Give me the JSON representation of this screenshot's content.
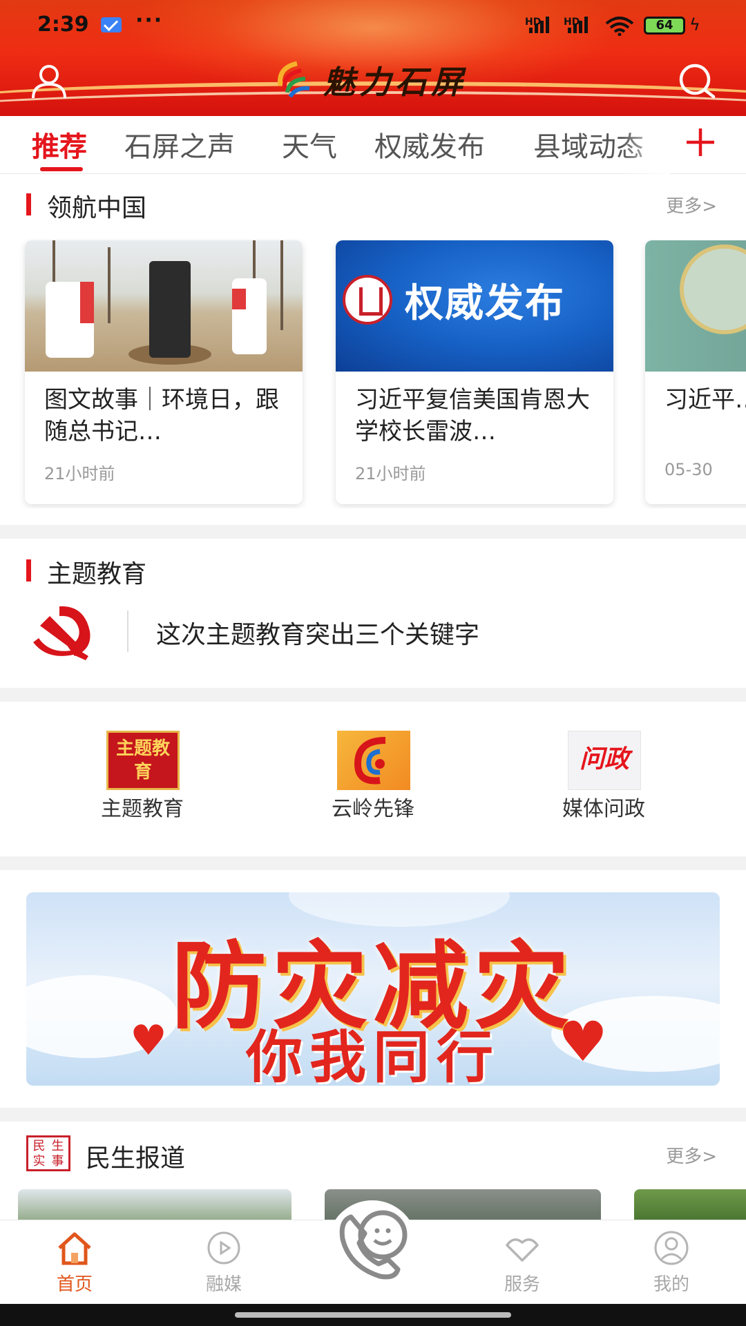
{
  "status_bar": {
    "time": "2:39",
    "dots": "···",
    "sim1_label": "HD",
    "sim2_label": "HD",
    "battery": "64"
  },
  "header": {
    "app_title": "魅力石屏",
    "icons": [
      "user-icon",
      "search-icon"
    ],
    "bg_color": "#e5221a"
  },
  "tabs": {
    "items": [
      "推荐",
      "石屏之声",
      "天气",
      "权威发布",
      "县域动态"
    ],
    "active_index": 0,
    "add_icon": "plus-icon",
    "accent": "#e5151c"
  },
  "lead_china": {
    "title": "领航中国",
    "more": "更多>",
    "cards": [
      {
        "title": "图文故事｜环境日，跟随总书记…",
        "time": "21小时前"
      },
      {
        "title": "习近平复信美国肯恩大学校长雷波…",
        "time": "21小时前",
        "thumb_text": "权威发布",
        "thumb_emblem": "XINHUA"
      },
      {
        "title": "习近平…作论坛…",
        "time": "05-30"
      }
    ]
  },
  "topic_education": {
    "title": "主题教育",
    "icon": "party-emblem-icon",
    "headline": "这次主题教育突出三个关键字"
  },
  "quick_links": [
    {
      "label": "主题教育",
      "icon_text": "主题教育"
    },
    {
      "label": "云岭先锋",
      "icon_text": ""
    },
    {
      "label": "媒体问政",
      "icon_text": "问政"
    }
  ],
  "banner": {
    "line1": "防灾减灾",
    "line2": "你我同行"
  },
  "minsheng": {
    "icon_chars": [
      "民",
      "生",
      "实",
      "事"
    ],
    "title": "民生报道",
    "more": "更多>"
  },
  "bottom_nav": {
    "items": [
      {
        "label": "首页",
        "icon": "home-icon"
      },
      {
        "label": "融媒",
        "icon": "media-icon"
      },
      {
        "label": "",
        "icon": "phone-smile-icon"
      },
      {
        "label": "服务",
        "icon": "handshake-icon"
      },
      {
        "label": "我的",
        "icon": "profile-icon"
      }
    ],
    "active_color": "#e0561c",
    "inactive_color": "#a8a8a8"
  }
}
